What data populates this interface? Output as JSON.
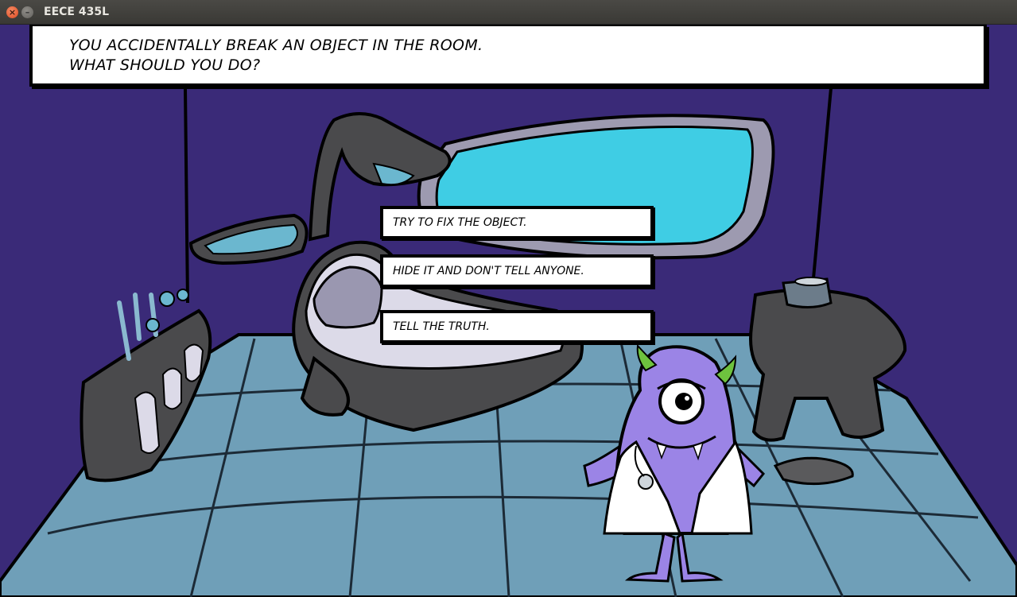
{
  "window": {
    "title": "EECE 435L",
    "close_glyph": "×",
    "minimize_glyph": "–"
  },
  "question": {
    "line1": "YOU ACCIDENTALLY BREAK AN OBJECT IN THE ROOM.",
    "line2": "WHAT SHOULD YOU DO?"
  },
  "choices": [
    {
      "label": "TRY TO FIX THE OBJECT."
    },
    {
      "label": "HIDE IT AND DON'T TELL ANYONE."
    },
    {
      "label": "TELL THE TRUTH."
    }
  ],
  "colors": {
    "wall": "#3a2a78",
    "floor": "#6f9fb8",
    "window_glass": "#3fcde4",
    "furniture": "#4a4a4c",
    "monster": "#9b84e6",
    "horns": "#6ec23e"
  }
}
